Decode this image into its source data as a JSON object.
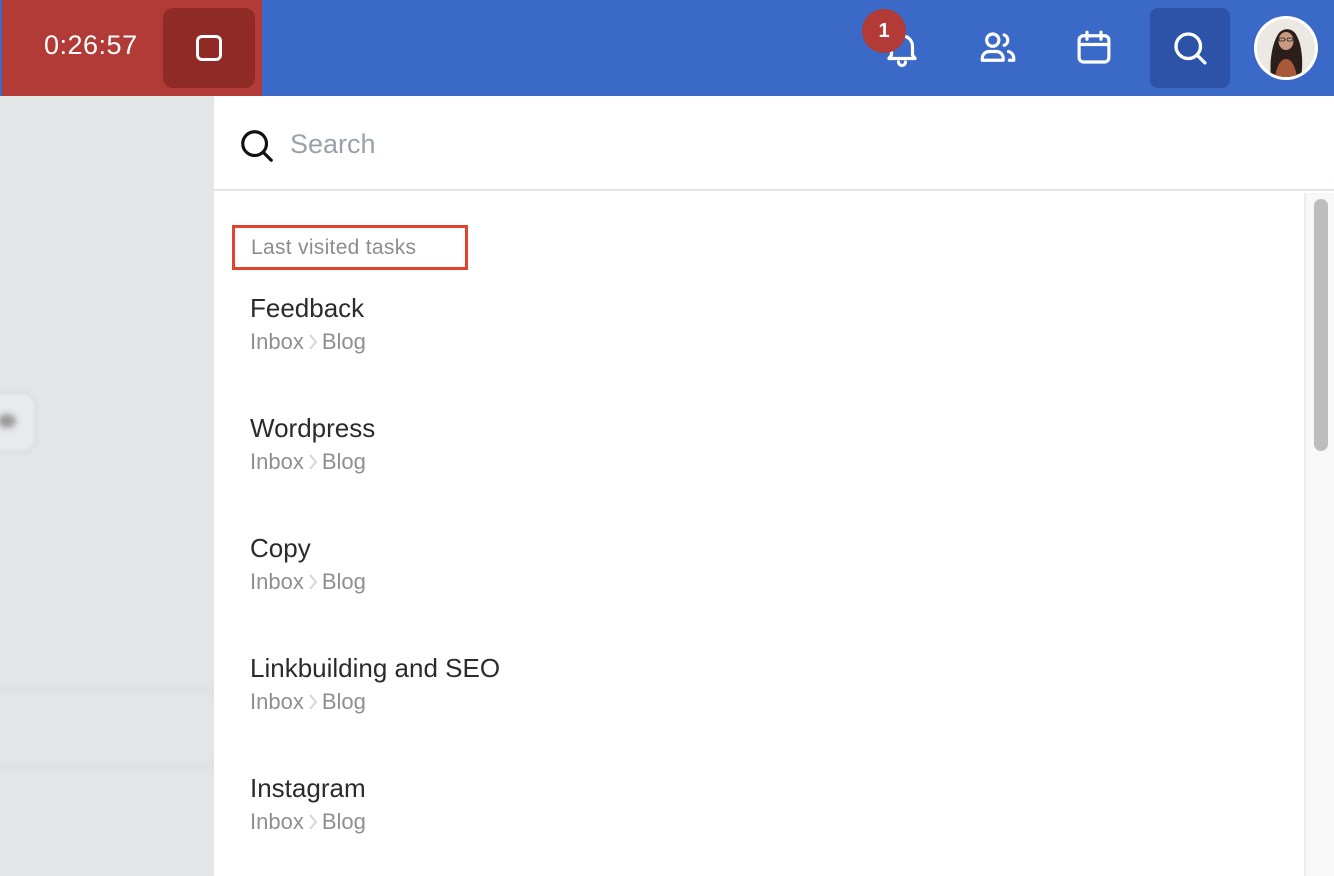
{
  "topbar": {
    "timer": "0:26:57",
    "stop_button": "stop-timer",
    "notification_count": "1",
    "icons": [
      "bell-icon",
      "people-icon",
      "calendar-icon",
      "search-icon"
    ],
    "colors": {
      "bar": "#3b69c7",
      "timer_bg": "#b23b37",
      "stop_bg": "#8f2a27",
      "search_active": "#2d53a8",
      "badge": "#b23b37"
    }
  },
  "search": {
    "placeholder": "Search",
    "value": ""
  },
  "results": {
    "section_label": "Last visited tasks",
    "tasks": [
      {
        "title": "Feedback",
        "path": [
          "Inbox",
          "Blog"
        ]
      },
      {
        "title": "Wordpress",
        "path": [
          "Inbox",
          "Blog"
        ]
      },
      {
        "title": "Copy",
        "path": [
          "Inbox",
          "Blog"
        ]
      },
      {
        "title": "Linkbuilding and SEO",
        "path": [
          "Inbox",
          "Blog"
        ]
      },
      {
        "title": "Instagram",
        "path": [
          "Inbox",
          "Blog"
        ]
      }
    ]
  },
  "annotation": {
    "highlight_color": "#e2432d"
  }
}
